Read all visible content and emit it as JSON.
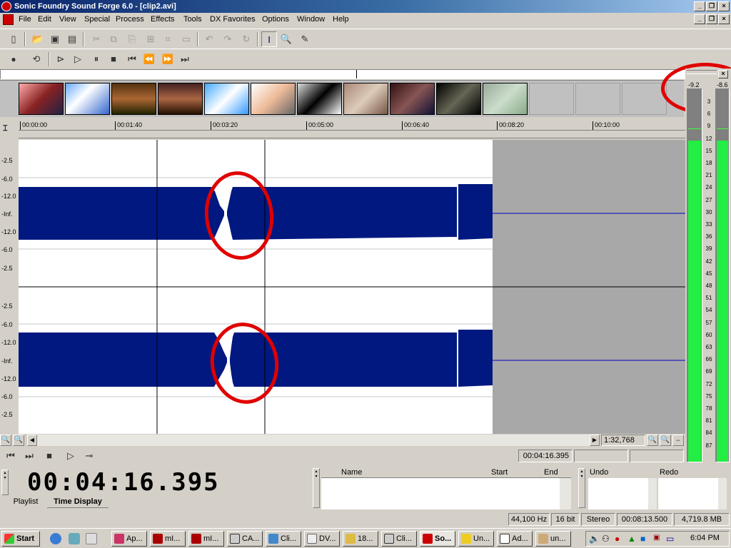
{
  "window": {
    "title": "Sonic Foundry Sound Forge 6.0 - [clip2.avi]"
  },
  "menu": [
    "File",
    "Edit",
    "View",
    "Special",
    "Process",
    "Effects",
    "Tools",
    "DX Favorites",
    "Options",
    "Window",
    "Help"
  ],
  "toolbar1": {
    "icons": [
      "new-icon",
      "open-icon",
      "save-icon",
      "save-as-icon",
      "cut-icon",
      "copy-icon",
      "paste-icon",
      "mix-icon",
      "crop-icon",
      "undo-icon",
      "redo-icon",
      "repeat-icon",
      "edit-tool-icon",
      "magnify-tool-icon",
      "pencil-tool-icon"
    ]
  },
  "toolbar2": {
    "icons": [
      "record-icon",
      "loop-icon",
      "play-all-icon",
      "play-icon",
      "pause-icon",
      "stop-icon",
      "go-start-icon",
      "rewind-icon",
      "forward-icon",
      "go-end-icon"
    ]
  },
  "ruler": {
    "ticks": [
      "00:00:00",
      "00:01:40",
      "00:03:20",
      "00:05:00",
      "00:06:40",
      "00:08:20",
      "00:10:00"
    ]
  },
  "db_labels": {
    "top": [
      "-2.5",
      "-6.0",
      "-12.0",
      "-Inf.",
      "-12.0",
      "-6.0",
      "-2.5"
    ],
    "bottom": [
      "-2.5",
      "-6.0",
      "-12.0",
      "-Inf.",
      "-12.0",
      "-6.0",
      "-2.5"
    ]
  },
  "meter": {
    "left_peak": "-9.2",
    "right_peak": "-8.6",
    "scale": [
      "3",
      "6",
      "9",
      "12",
      "15",
      "18",
      "21",
      "24",
      "27",
      "30",
      "33",
      "36",
      "39",
      "42",
      "45",
      "48",
      "51",
      "54",
      "57",
      "60",
      "63",
      "66",
      "69",
      "72",
      "75",
      "78",
      "81",
      "84",
      "87"
    ]
  },
  "zoom_ratio": "1:32,768",
  "position": "00:04:16.395",
  "time_display": "00:04:16.395",
  "tabs": [
    "Playlist",
    "Time Display"
  ],
  "regions": {
    "headers": [
      "Name",
      "Start",
      "End"
    ]
  },
  "undo_redo": {
    "undo": "Undo",
    "redo": "Redo"
  },
  "status": {
    "rate": "44,100 Hz",
    "bits": "16 bit",
    "channels": "Stereo",
    "length": "00:08:13.500",
    "disk": "4,719.8 MB"
  },
  "taskbar": {
    "start": "Start",
    "tasks": [
      "Ap...",
      "mI...",
      "mI...",
      "CA...",
      "Cli...",
      "DV...",
      "18...",
      "Cli...",
      "So...",
      "Un...",
      "Ad...",
      "un..."
    ],
    "clock": "6:04 PM"
  },
  "colors": {
    "waveform": "#001880",
    "title_start": "#0a246a",
    "meter_green": "#22ee44",
    "annotation": "#e00000"
  }
}
